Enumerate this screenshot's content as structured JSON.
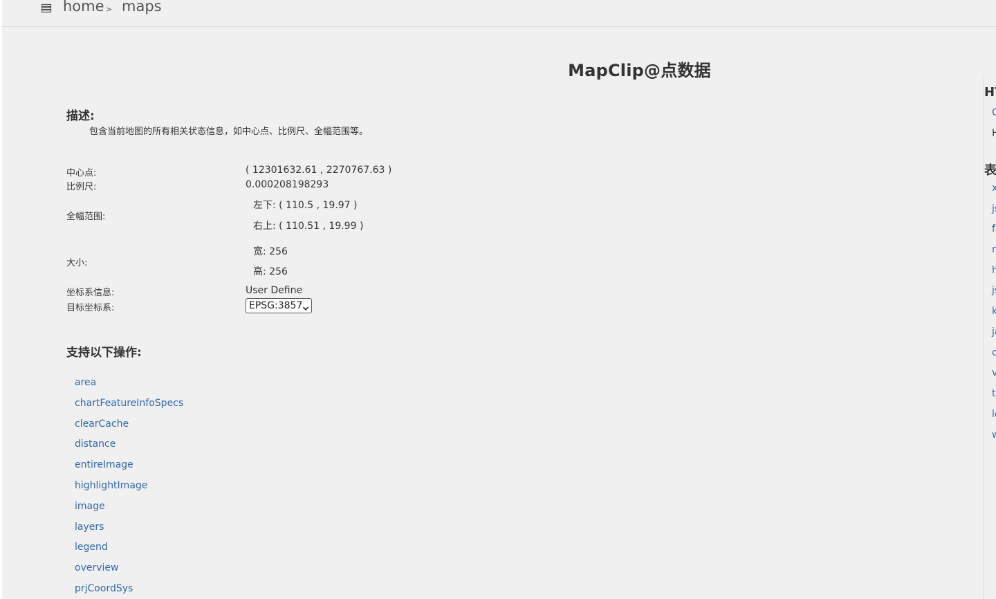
{
  "breadcrumb": {
    "icon": "list-icon",
    "home": "home",
    "separator": ">",
    "current": "maps"
  },
  "page": {
    "title": "MapClip@点数据"
  },
  "description": {
    "heading": "描述:",
    "text": "包含当前地图的所有相关状态信息，如中心点、比例尺、全幅范围等。"
  },
  "info": {
    "center_label": "中心点:",
    "center_value": "( 12301632.61 , 2270767.63 )",
    "scale_label": "比例尺:",
    "scale_value": "0.000208198293",
    "bounds_label": "全幅范围:",
    "bounds_lower_left": "左下: ( 110.5 , 19.97 )",
    "bounds_upper_right": "右上: ( 110.51 , 19.99 )",
    "size_label": "大小:",
    "size_width": "宽: 256",
    "size_height": "高: 256",
    "crs_label": "坐标系信息:",
    "crs_value": "User Define",
    "target_crs_label": "目标坐标系:",
    "target_crs_selected": "EPSG:3857"
  },
  "operations": {
    "heading": "支持以下操作:",
    "items": [
      "area",
      "chartFeatureInfoSpecs",
      "clearCache",
      "distance",
      "entireImage",
      "highlightImage",
      "image",
      "layers",
      "legend",
      "overview",
      "prjCoordSys"
    ]
  },
  "side_panel": {
    "heading_1": "HT",
    "item_1": "G",
    "item_2": "H",
    "heading_2": "表",
    "links": [
      "x",
      "js",
      "fa",
      "rj",
      "h",
      "js",
      "k",
      "ja",
      "c",
      "v",
      "t",
      "le",
      "w"
    ]
  }
}
